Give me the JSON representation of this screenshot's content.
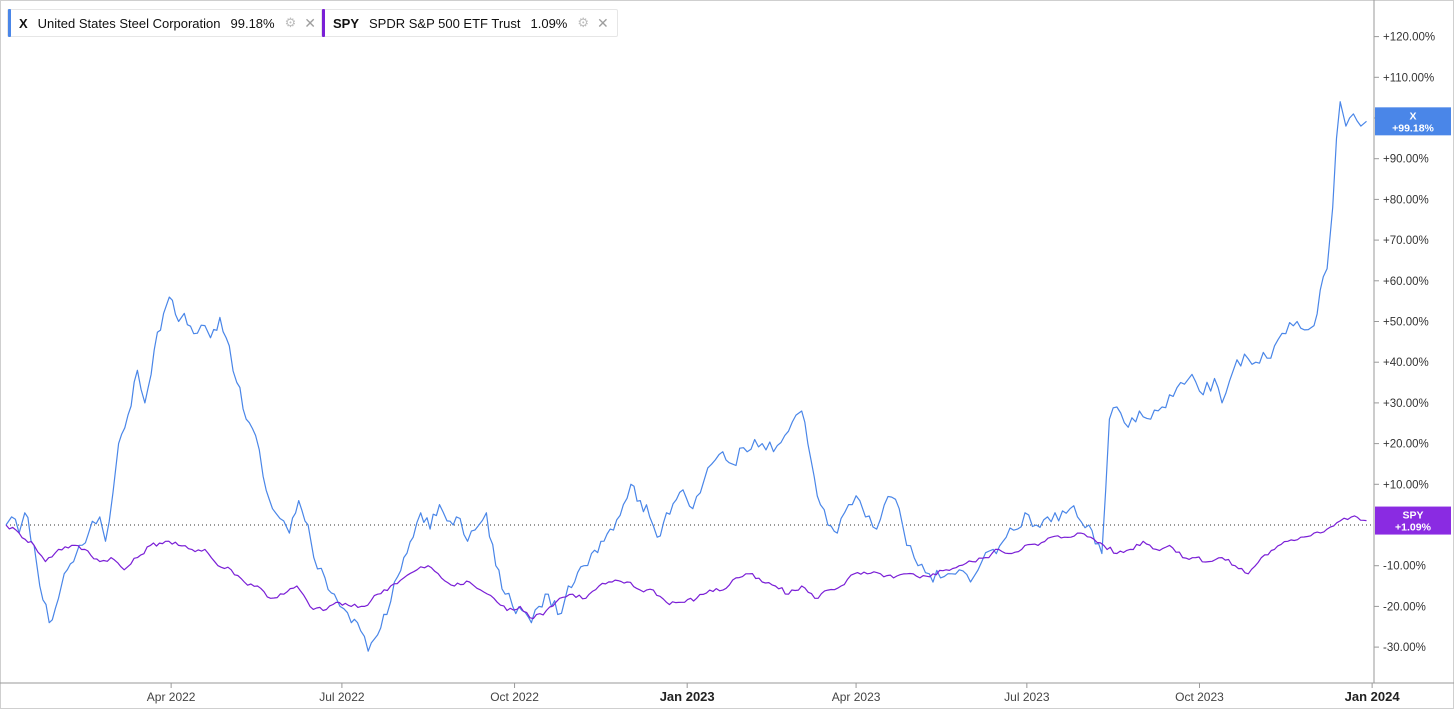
{
  "legend": [
    {
      "ticker": "X",
      "name": "United States Steel Corporation",
      "value": "99.18%",
      "color": "#4a86e8"
    },
    {
      "ticker": "SPY",
      "name": "SPDR S&P 500 ETF Trust",
      "value": "1.09%",
      "color": "#7a1fd6"
    }
  ],
  "badges": [
    {
      "ticker": "X",
      "value": "+99.18%",
      "color": "#4a86e8"
    },
    {
      "ticker": "SPY",
      "value": "+1.09%",
      "color": "#8a2be2"
    }
  ],
  "chart_data": {
    "type": "line",
    "title": "",
    "xlabel": "",
    "ylabel": "",
    "y_unit": "%",
    "ylim": [
      -38,
      128
    ],
    "x_range": [
      "2022-01-03",
      "2023-12-29"
    ],
    "y_ticks": [
      "+120.00%",
      "+110.00%",
      "+100.00%",
      "+90.00%",
      "+80.00%",
      "+70.00%",
      "+60.00%",
      "+50.00%",
      "+40.00%",
      "+30.00%",
      "+20.00%",
      "+10.00%",
      "-10.00%",
      "-20.00%",
      "-30.00%"
    ],
    "y_tick_values": [
      120,
      110,
      100,
      90,
      80,
      70,
      60,
      50,
      40,
      30,
      20,
      10,
      -10,
      -20,
      -30
    ],
    "x_ticks": [
      {
        "label": "Apr 2022",
        "date": "2022-04-01",
        "bold": false
      },
      {
        "label": "Jul 2022",
        "date": "2022-07-01",
        "bold": false
      },
      {
        "label": "Oct 2022",
        "date": "2022-10-01",
        "bold": false
      },
      {
        "label": "Jan 2023",
        "date": "2023-01-01",
        "bold": true
      },
      {
        "label": "Apr 2023",
        "date": "2023-04-01",
        "bold": false
      },
      {
        "label": "Jul 2023",
        "date": "2023-07-01",
        "bold": false
      },
      {
        "label": "Oct 2023",
        "date": "2023-10-01",
        "bold": false
      },
      {
        "label": "Jan 2024",
        "date": "2024-01-01",
        "bold": true
      }
    ],
    "baseline": 0,
    "grid": false,
    "series": [
      {
        "name": "X",
        "color": "#4a86e8",
        "points": [
          [
            "2022-01-03",
            0
          ],
          [
            "2022-01-06",
            2
          ],
          [
            "2022-01-10",
            -2
          ],
          [
            "2022-01-13",
            3
          ],
          [
            "2022-01-18",
            -5
          ],
          [
            "2022-01-21",
            -15
          ],
          [
            "2022-01-26",
            -24
          ],
          [
            "2022-01-31",
            -18
          ],
          [
            "2022-02-03",
            -12
          ],
          [
            "2022-02-08",
            -9
          ],
          [
            "2022-02-11",
            -5
          ],
          [
            "2022-02-16",
            -2
          ],
          [
            "2022-02-22",
            2
          ],
          [
            "2022-02-25",
            -4
          ],
          [
            "2022-03-01",
            8
          ],
          [
            "2022-03-04",
            20
          ],
          [
            "2022-03-09",
            27
          ],
          [
            "2022-03-14",
            38
          ],
          [
            "2022-03-18",
            30
          ],
          [
            "2022-03-23",
            43
          ],
          [
            "2022-03-28",
            52
          ],
          [
            "2022-03-31",
            56
          ],
          [
            "2022-04-05",
            50
          ],
          [
            "2022-04-08",
            52
          ],
          [
            "2022-04-13",
            47
          ],
          [
            "2022-04-19",
            49
          ],
          [
            "2022-04-22",
            46
          ],
          [
            "2022-04-27",
            51
          ],
          [
            "2022-05-02",
            44
          ],
          [
            "2022-05-06",
            35
          ],
          [
            "2022-05-11",
            26
          ],
          [
            "2022-05-16",
            22
          ],
          [
            "2022-05-20",
            12
          ],
          [
            "2022-05-25",
            4
          ],
          [
            "2022-05-31",
            1
          ],
          [
            "2022-06-03",
            -2
          ],
          [
            "2022-06-08",
            6
          ],
          [
            "2022-06-13",
            0
          ],
          [
            "2022-06-16",
            -8
          ],
          [
            "2022-06-22",
            -13
          ],
          [
            "2022-06-27",
            -17
          ],
          [
            "2022-06-30",
            -20
          ],
          [
            "2022-07-06",
            -24
          ],
          [
            "2022-07-11",
            -26
          ],
          [
            "2022-07-15",
            -31
          ],
          [
            "2022-07-20",
            -27
          ],
          [
            "2022-07-25",
            -22
          ],
          [
            "2022-07-29",
            -14
          ],
          [
            "2022-08-03",
            -8
          ],
          [
            "2022-08-08",
            -3
          ],
          [
            "2022-08-12",
            3
          ],
          [
            "2022-08-17",
            -1
          ],
          [
            "2022-08-22",
            5
          ],
          [
            "2022-08-26",
            1
          ],
          [
            "2022-08-31",
            2
          ],
          [
            "2022-09-06",
            -4
          ],
          [
            "2022-09-12",
            0
          ],
          [
            "2022-09-16",
            3
          ],
          [
            "2022-09-21",
            -10
          ],
          [
            "2022-09-26",
            -17
          ],
          [
            "2022-09-30",
            -20
          ],
          [
            "2022-10-05",
            -21
          ],
          [
            "2022-10-10",
            -24
          ],
          [
            "2022-10-14",
            -20
          ],
          [
            "2022-10-19",
            -17
          ],
          [
            "2022-10-24",
            -22
          ],
          [
            "2022-10-28",
            -18
          ],
          [
            "2022-11-02",
            -14
          ],
          [
            "2022-11-07",
            -10
          ],
          [
            "2022-11-11",
            -7
          ],
          [
            "2022-11-16",
            -4
          ],
          [
            "2022-11-21",
            -1
          ],
          [
            "2022-11-28",
            5
          ],
          [
            "2022-12-02",
            10
          ],
          [
            "2022-12-07",
            6
          ],
          [
            "2022-12-12",
            2
          ],
          [
            "2022-12-16",
            -3
          ],
          [
            "2022-12-21",
            3
          ],
          [
            "2022-12-28",
            8
          ],
          [
            "2023-01-04",
            4
          ],
          [
            "2023-01-10",
            11
          ],
          [
            "2023-01-16",
            16
          ],
          [
            "2023-01-20",
            18
          ],
          [
            "2023-01-25",
            15
          ],
          [
            "2023-01-31",
            19
          ],
          [
            "2023-02-06",
            21
          ],
          [
            "2023-02-10",
            20
          ],
          [
            "2023-02-16",
            18
          ],
          [
            "2023-02-22",
            22
          ],
          [
            "2023-02-28",
            27
          ],
          [
            "2023-03-03",
            28
          ],
          [
            "2023-03-08",
            16
          ],
          [
            "2023-03-13",
            5
          ],
          [
            "2023-03-17",
            0
          ],
          [
            "2023-03-22",
            -2
          ],
          [
            "2023-03-28",
            5
          ],
          [
            "2023-04-03",
            6
          ],
          [
            "2023-04-06",
            2
          ],
          [
            "2023-04-12",
            -1
          ],
          [
            "2023-04-18",
            7
          ],
          [
            "2023-04-24",
            4
          ],
          [
            "2023-04-28",
            -5
          ],
          [
            "2023-05-04",
            -10
          ],
          [
            "2023-05-10",
            -12
          ],
          [
            "2023-05-16",
            -13
          ],
          [
            "2023-05-22",
            -12
          ],
          [
            "2023-05-26",
            -11
          ],
          [
            "2023-06-01",
            -14
          ],
          [
            "2023-06-07",
            -9
          ],
          [
            "2023-06-13",
            -6
          ],
          [
            "2023-06-20",
            -3
          ],
          [
            "2023-06-26",
            -1
          ],
          [
            "2023-06-30",
            3
          ],
          [
            "2023-07-06",
            0
          ],
          [
            "2023-07-12",
            2
          ],
          [
            "2023-07-18",
            1
          ],
          [
            "2023-07-24",
            4
          ],
          [
            "2023-07-28",
            2
          ],
          [
            "2023-08-03",
            0
          ],
          [
            "2023-08-10",
            -7
          ],
          [
            "2023-08-14",
            26
          ],
          [
            "2023-08-18",
            29
          ],
          [
            "2023-08-24",
            24
          ],
          [
            "2023-08-30",
            28
          ],
          [
            "2023-09-05",
            26
          ],
          [
            "2023-09-11",
            29
          ],
          [
            "2023-09-15",
            32
          ],
          [
            "2023-09-21",
            35
          ],
          [
            "2023-09-27",
            37
          ],
          [
            "2023-10-03",
            32
          ],
          [
            "2023-10-09",
            36
          ],
          [
            "2023-10-13",
            30
          ],
          [
            "2023-10-19",
            38
          ],
          [
            "2023-10-25",
            42
          ],
          [
            "2023-10-31",
            40
          ],
          [
            "2023-11-06",
            41
          ],
          [
            "2023-11-10",
            44
          ],
          [
            "2023-11-16",
            47
          ],
          [
            "2023-11-22",
            50
          ],
          [
            "2023-11-28",
            48
          ],
          [
            "2023-12-01",
            49
          ],
          [
            "2023-12-06",
            61
          ],
          [
            "2023-12-08",
            63
          ],
          [
            "2023-12-11",
            78
          ],
          [
            "2023-12-13",
            95
          ],
          [
            "2023-12-15",
            104
          ],
          [
            "2023-12-18",
            98
          ],
          [
            "2023-12-20",
            100
          ],
          [
            "2023-12-22",
            101
          ],
          [
            "2023-12-26",
            98
          ],
          [
            "2023-12-29",
            99.18
          ]
        ]
      },
      {
        "name": "SPY",
        "color": "#7a1fd6",
        "points": [
          [
            "2022-01-03",
            0
          ],
          [
            "2022-01-10",
            -2
          ],
          [
            "2022-01-18",
            -5
          ],
          [
            "2022-01-24",
            -9
          ],
          [
            "2022-01-31",
            -6
          ],
          [
            "2022-02-07",
            -5
          ],
          [
            "2022-02-14",
            -6
          ],
          [
            "2022-02-22",
            -9
          ],
          [
            "2022-02-28",
            -8
          ],
          [
            "2022-03-07",
            -11
          ],
          [
            "2022-03-14",
            -8
          ],
          [
            "2022-03-21",
            -5
          ],
          [
            "2022-03-29",
            -4
          ],
          [
            "2022-04-05",
            -5
          ],
          [
            "2022-04-12",
            -6
          ],
          [
            "2022-04-19",
            -6
          ],
          [
            "2022-04-26",
            -10
          ],
          [
            "2022-05-03",
            -11
          ],
          [
            "2022-05-10",
            -14
          ],
          [
            "2022-05-17",
            -15
          ],
          [
            "2022-05-24",
            -18
          ],
          [
            "2022-05-31",
            -17
          ],
          [
            "2022-06-07",
            -15
          ],
          [
            "2022-06-14",
            -20
          ],
          [
            "2022-06-21",
            -21
          ],
          [
            "2022-06-28",
            -19
          ],
          [
            "2022-07-06",
            -20
          ],
          [
            "2022-07-13",
            -20
          ],
          [
            "2022-07-20",
            -17
          ],
          [
            "2022-07-27",
            -15
          ],
          [
            "2022-08-03",
            -13
          ],
          [
            "2022-08-10",
            -11
          ],
          [
            "2022-08-16",
            -10
          ],
          [
            "2022-08-23",
            -13
          ],
          [
            "2022-08-30",
            -15
          ],
          [
            "2022-09-07",
            -14
          ],
          [
            "2022-09-13",
            -16
          ],
          [
            "2022-09-20",
            -18
          ],
          [
            "2022-09-27",
            -21
          ],
          [
            "2022-10-04",
            -20
          ],
          [
            "2022-10-11",
            -23
          ],
          [
            "2022-10-18",
            -21
          ],
          [
            "2022-10-25",
            -18
          ],
          [
            "2022-11-01",
            -17
          ],
          [
            "2022-11-08",
            -18
          ],
          [
            "2022-11-15",
            -15
          ],
          [
            "2022-11-22",
            -14
          ],
          [
            "2022-11-30",
            -14
          ],
          [
            "2022-12-07",
            -16
          ],
          [
            "2022-12-14",
            -16
          ],
          [
            "2022-12-21",
            -19
          ],
          [
            "2022-12-29",
            -19
          ],
          [
            "2023-01-06",
            -18
          ],
          [
            "2023-01-13",
            -16
          ],
          [
            "2023-01-20",
            -16
          ],
          [
            "2023-01-27",
            -13
          ],
          [
            "2023-02-03",
            -12
          ],
          [
            "2023-02-10",
            -14
          ],
          [
            "2023-02-17",
            -15
          ],
          [
            "2023-02-24",
            -17
          ],
          [
            "2023-03-03",
            -15
          ],
          [
            "2023-03-10",
            -18
          ],
          [
            "2023-03-17",
            -16
          ],
          [
            "2023-03-24",
            -15
          ],
          [
            "2023-03-31",
            -12
          ],
          [
            "2023-04-07",
            -12
          ],
          [
            "2023-04-14",
            -12
          ],
          [
            "2023-04-21",
            -13
          ],
          [
            "2023-04-28",
            -12
          ],
          [
            "2023-05-05",
            -13
          ],
          [
            "2023-05-12",
            -12
          ],
          [
            "2023-05-19",
            -11
          ],
          [
            "2023-05-26",
            -10
          ],
          [
            "2023-06-02",
            -9
          ],
          [
            "2023-06-09",
            -8
          ],
          [
            "2023-06-16",
            -6
          ],
          [
            "2023-06-23",
            -7
          ],
          [
            "2023-06-30",
            -5
          ],
          [
            "2023-07-07",
            -5
          ],
          [
            "2023-07-14",
            -3
          ],
          [
            "2023-07-21",
            -3
          ],
          [
            "2023-07-28",
            -2
          ],
          [
            "2023-08-04",
            -3
          ],
          [
            "2023-08-11",
            -5
          ],
          [
            "2023-08-18",
            -7
          ],
          [
            "2023-08-25",
            -6
          ],
          [
            "2023-09-01",
            -4
          ],
          [
            "2023-09-08",
            -6
          ],
          [
            "2023-09-15",
            -5
          ],
          [
            "2023-09-22",
            -8
          ],
          [
            "2023-09-29",
            -8
          ],
          [
            "2023-10-06",
            -9
          ],
          [
            "2023-10-13",
            -8
          ],
          [
            "2023-10-20",
            -10
          ],
          [
            "2023-10-27",
            -12
          ],
          [
            "2023-11-03",
            -8
          ],
          [
            "2023-11-10",
            -6
          ],
          [
            "2023-11-17",
            -4
          ],
          [
            "2023-11-24",
            -3
          ],
          [
            "2023-12-01",
            -2
          ],
          [
            "2023-12-08",
            -1
          ],
          [
            "2023-12-15",
            1
          ],
          [
            "2023-12-21",
            2
          ],
          [
            "2023-12-29",
            1.09
          ]
        ]
      }
    ]
  }
}
